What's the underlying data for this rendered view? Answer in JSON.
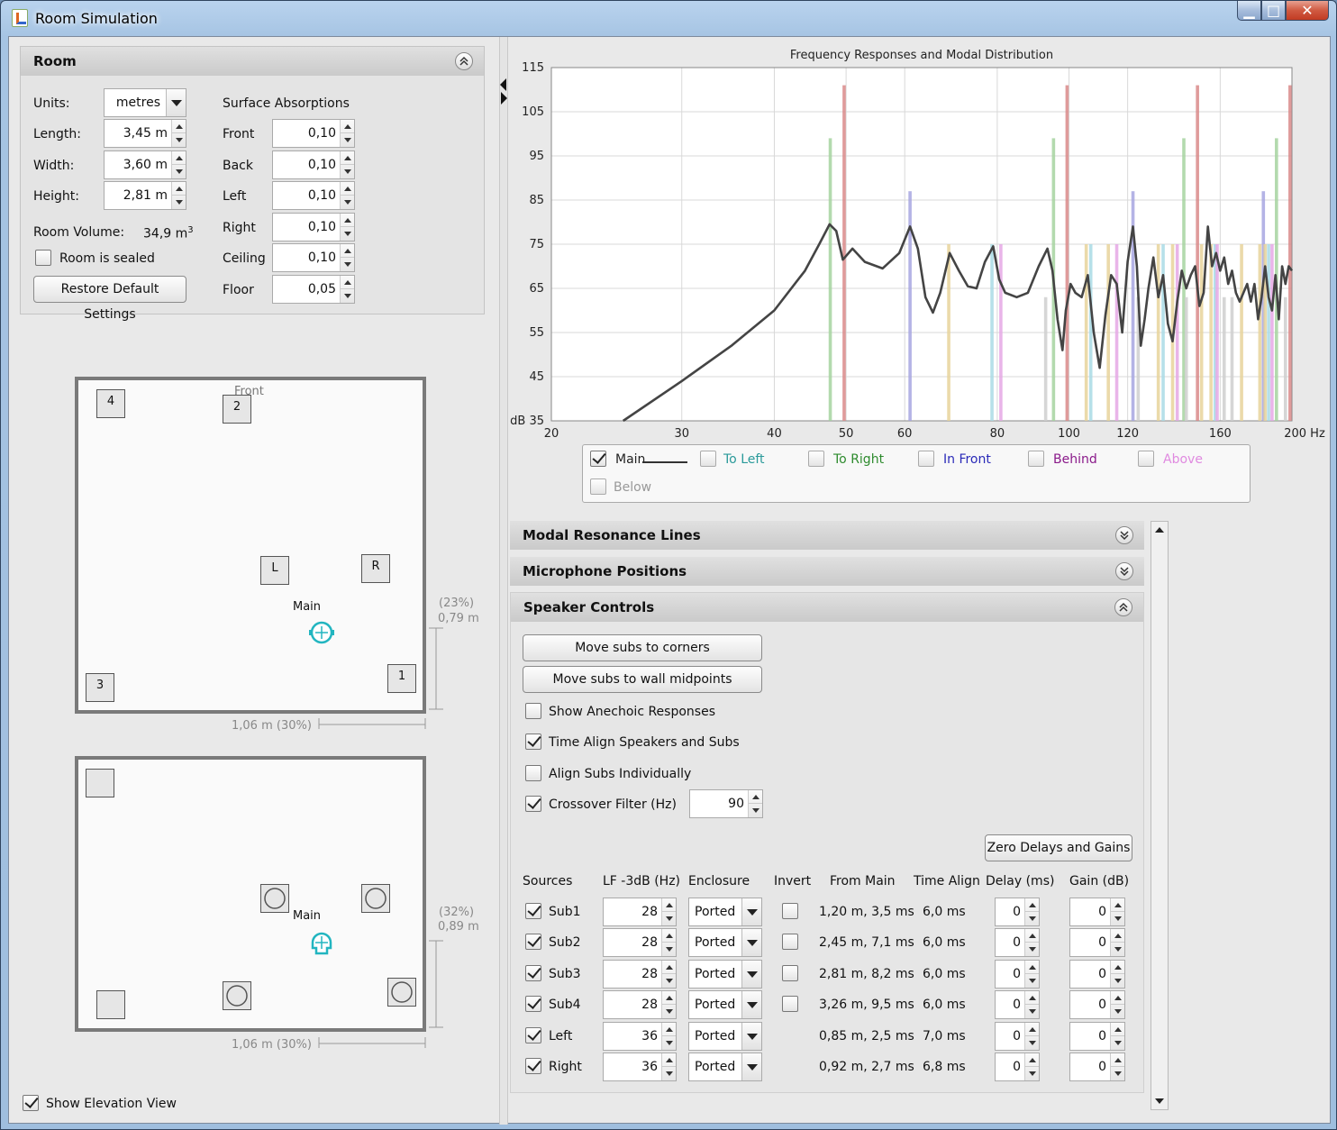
{
  "window": {
    "title": "Room Simulation",
    "close_glyph": "✕",
    "minimize_glyph": "▁",
    "maximize_glyph": "□"
  },
  "room": {
    "header": "Room",
    "units_label": "Units:",
    "units_value": "metres",
    "length_label": "Length:",
    "length_value": "3,45 m",
    "width_label": "Width:",
    "width_value": "3,60 m",
    "height_label": "Height:",
    "height_value": "2,81 m",
    "volume_label": "Room Volume:",
    "volume_value": "34,9 m",
    "volume_sup": "3",
    "sealed_label": "Room is sealed",
    "sealed_checked": false,
    "restore_label": "Restore Default Settings",
    "absorptions_title": "Surface Absorptions",
    "absorptions": [
      {
        "label": "Front",
        "value": "0,10"
      },
      {
        "label": "Back",
        "value": "0,10"
      },
      {
        "label": "Left",
        "value": "0,10"
      },
      {
        "label": "Right",
        "value": "0,10"
      },
      {
        "label": "Ceiling",
        "value": "0,10"
      },
      {
        "label": "Floor",
        "value": "0,05"
      }
    ]
  },
  "plan_view": {
    "front_label": "Front",
    "main_label": "Main",
    "speakers": [
      "4",
      "2",
      "L",
      "R",
      "3",
      "1"
    ],
    "dim_x": "1,06 m (30%)",
    "dim_y_pct": "(23%)",
    "dim_y": "0,79 m"
  },
  "elevation_view": {
    "main_label": "Main",
    "dim_x": "1,06 m (30%)",
    "dim_y_pct": "(32%)",
    "dim_y": "0,89 m"
  },
  "show_elevation": {
    "label": "Show Elevation View",
    "checked": true
  },
  "chart_data": {
    "type": "line",
    "title": "Frequency Responses and Modal Distribution",
    "x_scale": "log",
    "xlim": [
      20,
      200
    ],
    "ylim": [
      35,
      115
    ],
    "x_ticks": [
      20,
      30,
      40,
      50,
      60,
      80,
      100,
      120,
      160,
      200
    ],
    "x_tick_labels": [
      "20",
      "30",
      "40",
      "50",
      "60",
      "80",
      "100",
      "120",
      "160",
      "200 Hz"
    ],
    "y_ticks": [
      35,
      45,
      55,
      65,
      75,
      85,
      95,
      105,
      115
    ],
    "y_tick_labels": [
      "dB 35",
      "45",
      "55",
      "65",
      "75",
      "85",
      "95",
      "105",
      "115"
    ],
    "grid": true,
    "series": [
      {
        "name": "Main",
        "color": "#444444",
        "x": [
          25,
          30,
          35,
          40,
          44,
          46,
          47.5,
          48.5,
          49.5,
          51,
          53,
          56,
          59,
          61,
          62.5,
          64,
          65.5,
          67,
          69,
          71,
          73,
          75,
          77,
          79,
          80.5,
          82,
          85,
          88,
          91,
          93.5,
          95,
          96.5,
          98,
          99,
          100.5,
          102,
          104,
          106,
          108,
          110,
          112,
          114,
          116,
          118,
          120,
          122,
          123.5,
          125,
          126.5,
          128,
          130,
          132,
          134,
          136,
          138,
          140,
          142,
          144,
          146,
          148,
          150,
          152,
          154,
          156,
          158,
          160,
          162,
          164,
          166,
          168,
          170,
          172,
          174,
          176,
          178,
          180,
          182,
          184,
          186,
          188,
          190,
          192,
          194,
          196,
          198,
          200
        ],
        "y": [
          35,
          44,
          52,
          60,
          69,
          75,
          79.5,
          78,
          71.5,
          74,
          71,
          69.5,
          73,
          79,
          74,
          63,
          59.5,
          64,
          73,
          69,
          65.5,
          65,
          71,
          74.5,
          67,
          64,
          63,
          64,
          70,
          74,
          69,
          58,
          51,
          60,
          66,
          64,
          63,
          68,
          55,
          47,
          59,
          68,
          66,
          55,
          71,
          79,
          70,
          52,
          58,
          65,
          72,
          63,
          68,
          57,
          53,
          62,
          69,
          65,
          68,
          70,
          61,
          64,
          79,
          70,
          73,
          69,
          72,
          66,
          69,
          64,
          62,
          64,
          66,
          62,
          66,
          58,
          63,
          70,
          63,
          60,
          68,
          58,
          70,
          66,
          70,
          69
        ]
      }
    ],
    "modal_lines": [
      {
        "group": "length",
        "color": "#d9898a",
        "freqs": [
          49.7,
          99.4,
          149.1,
          198.8
        ],
        "levels": [
          111,
          111,
          111,
          111
        ]
      },
      {
        "group": "width",
        "color": "#a6d3a0",
        "freqs": [
          47.6,
          95.3,
          142.9,
          190.6
        ],
        "levels": [
          99,
          99,
          99,
          99
        ]
      },
      {
        "group": "height",
        "color": "#a7a6e0",
        "freqs": [
          61,
          122,
          183
        ],
        "levels": [
          87,
          87,
          87
        ]
      },
      {
        "group": "tangential",
        "color": "#e8d49b",
        "freqs": [
          68.8,
          105.5,
          113,
          132,
          138,
          151,
          155.5,
          171,
          181,
          184
        ],
        "levels": [
          75,
          75,
          75,
          75,
          75,
          75,
          75,
          75,
          75,
          75
        ]
      },
      {
        "group": "tangential-2",
        "color": "#a9dbe5",
        "freqs": [
          78.7,
          107,
          134,
          157.5,
          186
        ],
        "levels": [
          75,
          75,
          75,
          75,
          75
        ]
      },
      {
        "group": "tangential-3",
        "color": "#e5a8e5",
        "freqs": [
          80.9,
          116,
          140,
          158.5,
          188
        ],
        "levels": [
          75,
          75,
          75,
          75,
          75
        ]
      },
      {
        "group": "oblique",
        "color": "#cfcfcf",
        "freqs": [
          93,
          124,
          144,
          162,
          166,
          196
        ],
        "levels": [
          63,
          63,
          63,
          63,
          63,
          63
        ]
      }
    ]
  },
  "legend": [
    {
      "label": "Main",
      "checked": true,
      "color": "#222222"
    },
    {
      "label": "To Left",
      "checked": false,
      "color": "#2a9a9a"
    },
    {
      "label": "To Right",
      "checked": false,
      "color": "#2e8b2e"
    },
    {
      "label": "In Front",
      "checked": false,
      "color": "#2a2ab8"
    },
    {
      "label": "Behind",
      "checked": false,
      "color": "#8a1a8a"
    },
    {
      "label": "Above",
      "checked": false,
      "color": "#e08ae0"
    },
    {
      "label": "Below",
      "checked": false,
      "color": "#999999"
    }
  ],
  "sections": {
    "modal_lines": "Modal Resonance Lines",
    "mic_positions": "Microphone Positions",
    "speaker_controls": "Speaker Controls"
  },
  "speaker_controls": {
    "move_corners": "Move subs to corners",
    "move_midpoints": "Move subs to wall midpoints",
    "show_anechoic": {
      "label": "Show Anechoic Responses",
      "checked": false
    },
    "time_align": {
      "label": "Time Align Speakers and Subs",
      "checked": true
    },
    "align_individually": {
      "label": "Align Subs Individually",
      "checked": false
    },
    "crossover": {
      "label": "Crossover Filter (Hz)",
      "checked": true,
      "value": "90"
    },
    "zero_button": "Zero Delays and Gains",
    "columns": [
      "Sources",
      "LF -3dB (Hz)",
      "Enclosure",
      "Invert",
      "From Main",
      "Time Align",
      "Delay (ms)",
      "Gain (dB)"
    ],
    "rows": [
      {
        "name": "Sub1",
        "checked": true,
        "lf": "28",
        "enclosure": "Ported",
        "invert": true,
        "from_main": "1,20 m, 3,5 ms",
        "time_align": "6,0 ms",
        "delay": "0",
        "gain": "0"
      },
      {
        "name": "Sub2",
        "checked": true,
        "lf": "28",
        "enclosure": "Ported",
        "invert": true,
        "from_main": "2,45 m, 7,1 ms",
        "time_align": "6,0 ms",
        "delay": "0",
        "gain": "0"
      },
      {
        "name": "Sub3",
        "checked": true,
        "lf": "28",
        "enclosure": "Ported",
        "invert": true,
        "from_main": "2,81 m, 8,2 ms",
        "time_align": "6,0 ms",
        "delay": "0",
        "gain": "0"
      },
      {
        "name": "Sub4",
        "checked": true,
        "lf": "28",
        "enclosure": "Ported",
        "invert": true,
        "from_main": "3,26 m, 9,5 ms",
        "time_align": "6,0 ms",
        "delay": "0",
        "gain": "0"
      },
      {
        "name": "Left",
        "checked": true,
        "lf": "36",
        "enclosure": "Ported",
        "invert": false,
        "from_main": "0,85 m, 2,5 ms",
        "time_align": "7,0 ms",
        "delay": "0",
        "gain": "0"
      },
      {
        "name": "Right",
        "checked": true,
        "lf": "36",
        "enclosure": "Ported",
        "invert": false,
        "from_main": "0,92 m, 2,7 ms",
        "time_align": "6,8 ms",
        "delay": "0",
        "gain": "0"
      }
    ]
  }
}
